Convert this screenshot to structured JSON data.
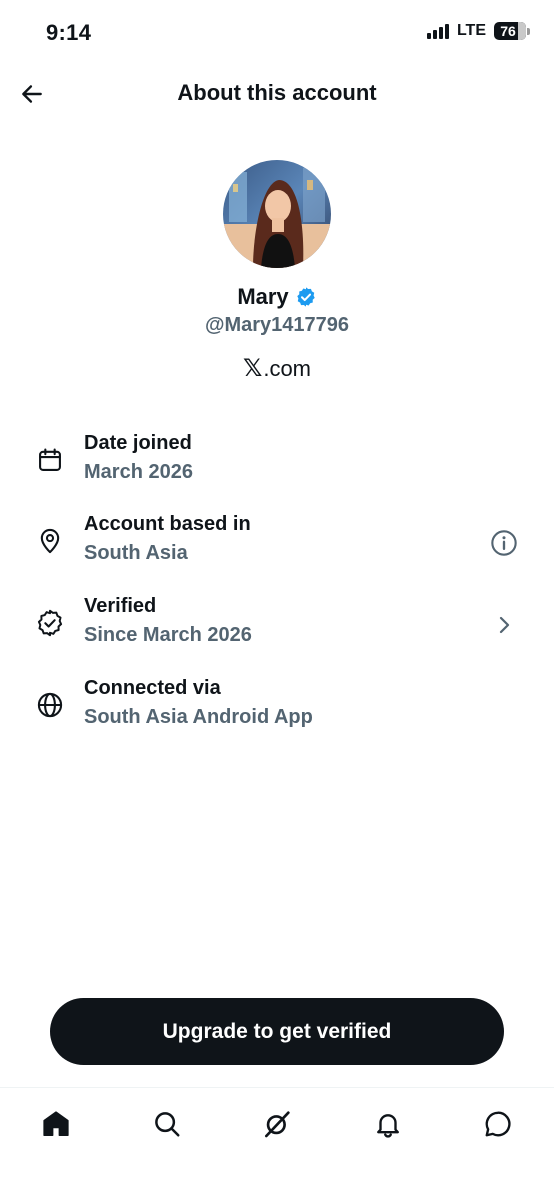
{
  "status_bar": {
    "time": "9:14",
    "network": "LTE",
    "battery_level": "76",
    "battery_fraction": 0.76
  },
  "header": {
    "title": "About this account",
    "back_icon": "arrow-left-icon"
  },
  "profile": {
    "display_name": "Mary",
    "handle": "@Mary1417796",
    "verified_badge_color": "#1d9bf0",
    "site_logo": "𝕏",
    "site_text": ".com"
  },
  "info_items": [
    {
      "icon": "calendar-icon",
      "label": "Date joined",
      "value": "March 2026",
      "action": ""
    },
    {
      "icon": "location-pin-icon",
      "label": "Account based in",
      "value": "South Asia",
      "action": "info-icon"
    },
    {
      "icon": "verified-badge-outline-icon",
      "label": "Verified",
      "value": "Since March 2026",
      "action": "chevron-right-icon"
    },
    {
      "icon": "globe-icon",
      "label": "Connected via",
      "value": "South Asia Android App",
      "action": ""
    }
  ],
  "cta": {
    "label": "Upgrade to get verified"
  },
  "bottom_nav": [
    {
      "icon": "home-icon",
      "active": true
    },
    {
      "icon": "search-icon",
      "active": false
    },
    {
      "icon": "grok-icon",
      "active": false
    },
    {
      "icon": "notifications-bell-icon",
      "active": false
    },
    {
      "icon": "messages-icon",
      "active": false
    }
  ],
  "colors": {
    "text_primary": "#0f1419",
    "text_secondary": "#536471",
    "accent": "#1d9bf0",
    "button_bg": "#0f1419",
    "divider": "#eff3f4"
  }
}
